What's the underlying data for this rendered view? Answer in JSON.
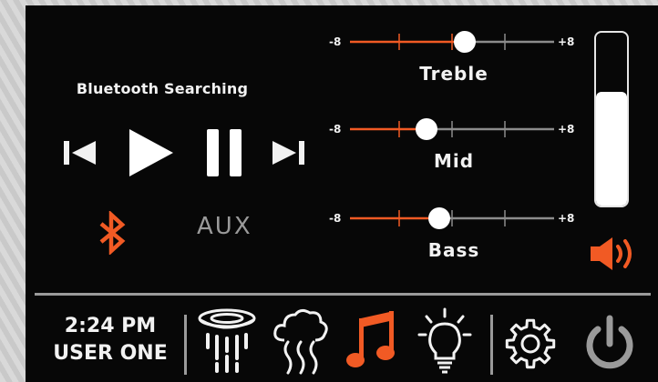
{
  "status_text": "Bluetooth Searching",
  "playback": {
    "icons": [
      "previous-track-icon",
      "play-icon",
      "pause-icon",
      "next-track-icon"
    ]
  },
  "sources": {
    "bluetooth_icon": "bluetooth-icon",
    "aux_label": "AUX"
  },
  "equalizer": {
    "min_label": "-8",
    "max_label": "+8",
    "bands": [
      {
        "label": "Treble",
        "value": 1
      },
      {
        "label": "Mid",
        "value": -2
      },
      {
        "label": "Bass",
        "value": -1
      }
    ]
  },
  "volume": {
    "level": 0.66
  },
  "clock": {
    "time": "2:24 PM",
    "user": "USER ONE"
  },
  "bottom_icons": [
    "rain-shower-icon",
    "steam-icon",
    "music-note-icon",
    "light-bulb-icon",
    "gear-icon",
    "power-icon"
  ],
  "colors": {
    "accent": "#f15a24",
    "track": "#8c8c8c",
    "text": "#f2f2f2",
    "background": "#070707"
  }
}
